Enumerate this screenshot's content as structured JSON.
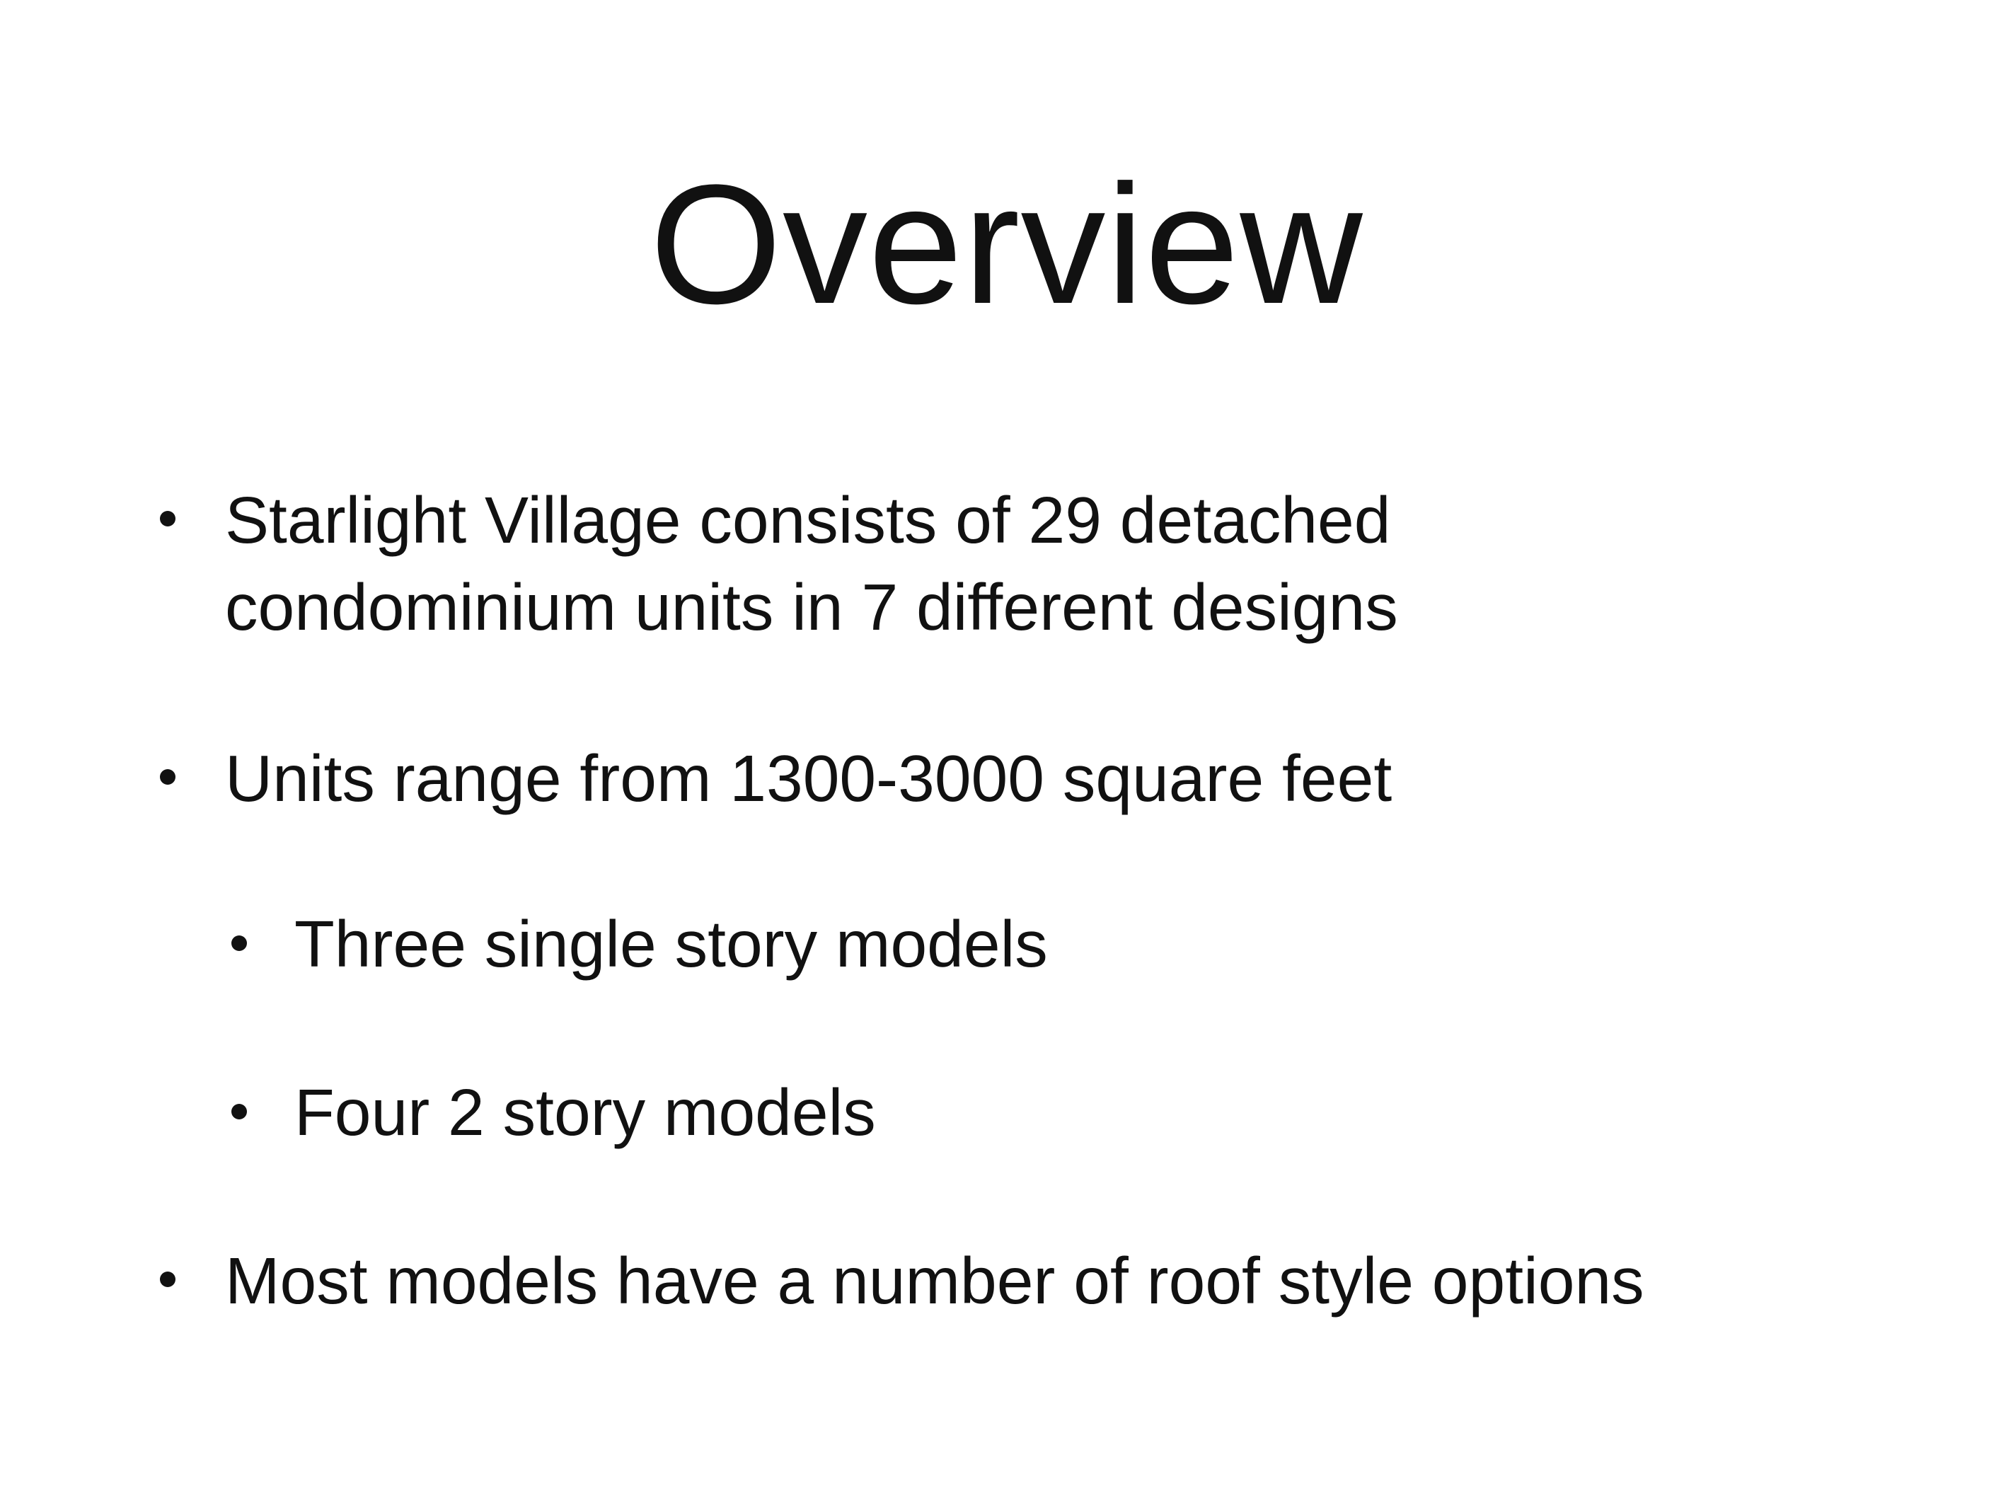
{
  "slide": {
    "title": "Overview",
    "bullets": [
      {
        "level": 1,
        "line1": "Starlight Village consists of 29 detached",
        "line2": "condominium units in 7 different designs"
      },
      {
        "level": 1,
        "text": "Units range from 1300-3000 square feet"
      },
      {
        "level": 2,
        "text": "Three single story models"
      },
      {
        "level": 2,
        "text": "Four 2 story models"
      },
      {
        "level": 1,
        "text": "Most models have a number of roof style options"
      }
    ]
  }
}
